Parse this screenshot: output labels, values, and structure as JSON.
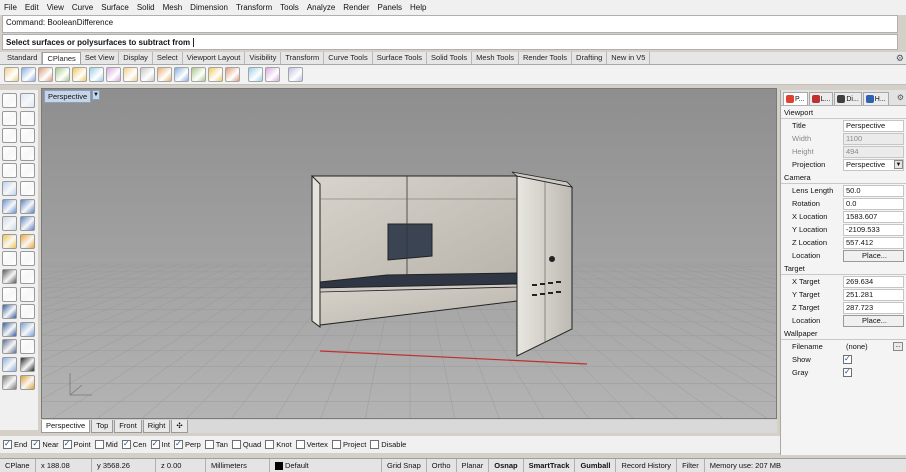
{
  "menu": [
    "File",
    "Edit",
    "View",
    "Curve",
    "Surface",
    "Solid",
    "Mesh",
    "Dimension",
    "Transform",
    "Tools",
    "Analyze",
    "Render",
    "Panels",
    "Help"
  ],
  "command_history": "Command: BooleanDifference",
  "command_prompt": "Select surfaces or polysurfaces to subtract from",
  "toolbar_tabs": [
    "Standard",
    "CPlanes",
    "Set View",
    "Display",
    "Select",
    "Viewport Layout",
    "Visibility",
    "Transform",
    "Curve Tools",
    "Surface Tools",
    "Solid Tools",
    "Mesh Tools",
    "Render Tools",
    "Drafting",
    "New in V5"
  ],
  "active_toolbar_tab": 1,
  "viewport": {
    "label": "Perspective"
  },
  "viewport_tabs": [
    "Perspective",
    "Top",
    "Front",
    "Right"
  ],
  "add_viewport_glyph": "✣",
  "osnaps": [
    {
      "label": "End",
      "checked": true
    },
    {
      "label": "Near",
      "checked": true
    },
    {
      "label": "Point",
      "checked": true
    },
    {
      "label": "Mid",
      "checked": false
    },
    {
      "label": "Cen",
      "checked": true
    },
    {
      "label": "Int",
      "checked": true
    },
    {
      "label": "Perp",
      "checked": true
    },
    {
      "label": "Tan",
      "checked": false
    },
    {
      "label": "Quad",
      "checked": false
    },
    {
      "label": "Knot",
      "checked": false
    },
    {
      "label": "Vertex",
      "checked": false
    },
    {
      "label": "Project",
      "checked": false
    },
    {
      "label": "Disable",
      "checked": false
    }
  ],
  "status": {
    "cplane": "CPlane",
    "x": "x 188.08",
    "y": "y 3568.26",
    "z": "z 0.00",
    "units": "Millimeters",
    "layer": "Default",
    "grid_snap": "Grid Snap",
    "ortho": "Ortho",
    "planar": "Planar",
    "osnap": "Osnap",
    "smarttrack": "SmartTrack",
    "gumball": "Gumball",
    "record_history": "Record History",
    "filter": "Filter",
    "memory": "Memory use: 207 MB"
  },
  "panel": {
    "tabs": [
      "P...",
      "L...",
      "Di...",
      "H..."
    ],
    "viewport_section": "Viewport",
    "title_label": "Title",
    "title_value": "Perspective",
    "width_label": "Width",
    "width_value": "1100",
    "height_label": "Height",
    "height_value": "494",
    "projection_label": "Projection",
    "projection_value": "Perspective",
    "camera_section": "Camera",
    "lens_label": "Lens Length",
    "lens_value": "50.0",
    "rotation_label": "Rotation",
    "rotation_value": "0.0",
    "xloc_label": "X Location",
    "xloc_value": "1583.607",
    "yloc_label": "Y Location",
    "yloc_value": "-2109.533",
    "zloc_label": "Z Location",
    "zloc_value": "557.412",
    "location_label": "Location",
    "place_button": "Place...",
    "target_section": "Target",
    "xtgt_label": "X Target",
    "xtgt_value": "269.634",
    "ytgt_label": "Y Target",
    "ytgt_value": "251.281",
    "ztgt_label": "Z Target",
    "ztgt_value": "287.723",
    "tlocation_label": "Location",
    "tplace_button": "Place...",
    "wallpaper_section": "Wallpaper",
    "filename_label": "Filename",
    "filename_value": "(none)",
    "browse_button": "...",
    "show_label": "Show",
    "gray_label": "Gray"
  },
  "colors": {
    "viewport_bg": "#a3a3a3",
    "x_axis": "#c03030",
    "y_axis": "#30a030",
    "object_face": "#cfcbc4"
  }
}
